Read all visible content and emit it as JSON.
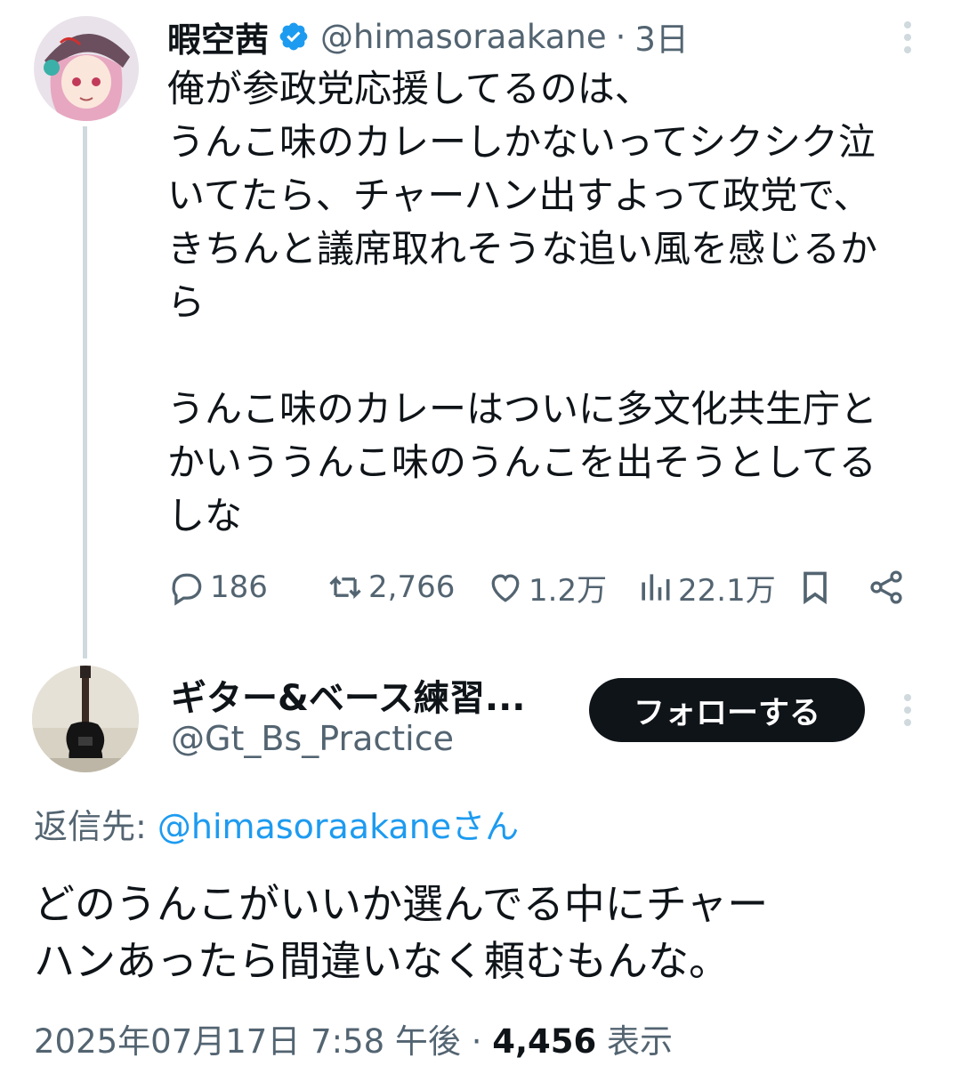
{
  "tweet1": {
    "author_name": "暇空茜",
    "handle": "@himasoraakane",
    "separator": "·",
    "time": "3日",
    "body_lines": [
      "俺が参政党応援してるのは、",
      "うんこ味のカレーしかないってシクシク泣",
      "いてたら、チャーハン出すよって政党で、",
      "きちんと議席取れそうな追い風を感じるか",
      "ら",
      "",
      "うんこ味のカレーはついに多文化共生庁と",
      "かいううんこ味のうんこを出そうとしてる",
      "しな"
    ],
    "stats": {
      "replies": "186",
      "reposts": "2,766",
      "likes": "1.2万",
      "views": "22.1万"
    }
  },
  "tweet2": {
    "author_name": "ギター&ベース練習...",
    "handle": "@Gt_Bs_Practice",
    "follow_label": "フォローする",
    "reply_prefix": "返信先: ",
    "reply_mention": "@himasoraakaneさん",
    "body_lines": [
      "どのうんこがいいか選んでる中にチャー",
      "ハンあったら間違いなく頼むもんな。"
    ],
    "timestamp": "2025年07月17日 7:58 午後",
    "separator": "·",
    "view_count": "4,456",
    "view_label": "表示"
  },
  "icons": {
    "verified": "verified-badge-icon",
    "more": "more-vertical-icon",
    "reply": "reply-icon",
    "repost": "repost-icon",
    "like": "heart-icon",
    "views": "views-chart-icon",
    "bookmark": "bookmark-icon",
    "share": "share-icon"
  },
  "colors": {
    "text": "#0f1419",
    "secondary": "#536471",
    "accent": "#1d9bf0",
    "thread_line": "#cfd9de",
    "follow_button_bg": "#0f1419"
  }
}
